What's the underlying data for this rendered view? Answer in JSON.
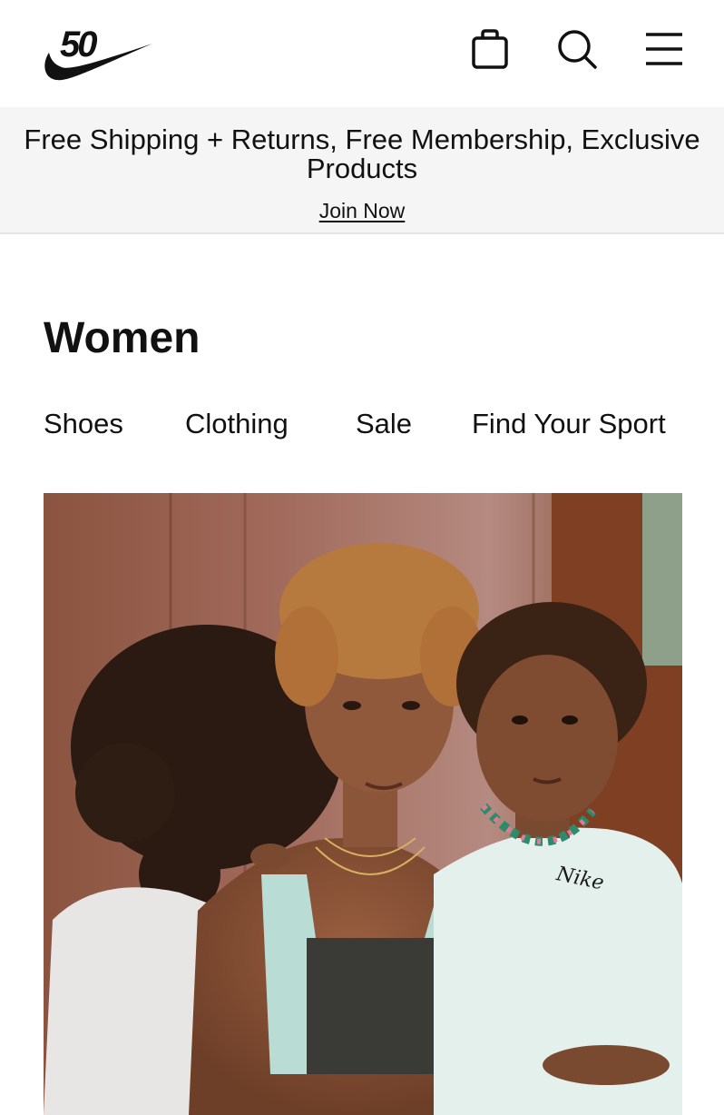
{
  "header": {
    "logo_text": "50",
    "icons": [
      "bag-icon",
      "search-icon",
      "menu-icon"
    ]
  },
  "promo": {
    "text": "Free Shipping + Returns, Free Membership, Exclusive Products",
    "link_label": "Join Now"
  },
  "page": {
    "title": "Women"
  },
  "category_nav": {
    "items": [
      {
        "label": "Shoes"
      },
      {
        "label": "Clothing"
      },
      {
        "label": "Sale"
      },
      {
        "label": "Find Your Sport"
      }
    ]
  },
  "hero": {
    "shirt_brand_text": "Nike"
  },
  "colors": {
    "text": "#111111",
    "promo_bg": "#f5f5f5",
    "divider": "#e5e5e5",
    "background": "#ffffff"
  }
}
